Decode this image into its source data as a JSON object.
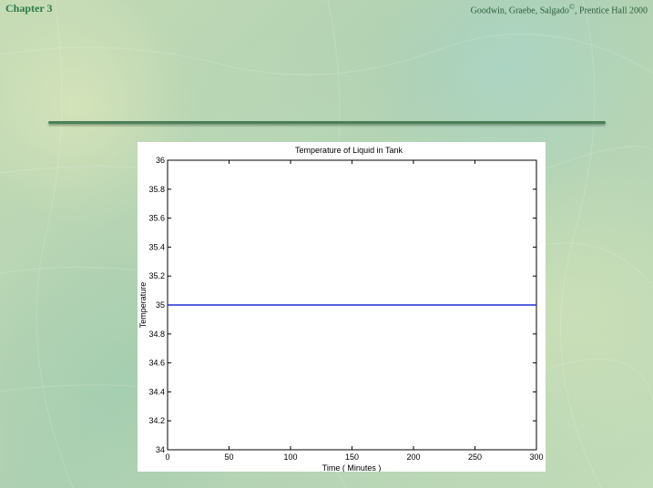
{
  "header": {
    "chapter": "Chapter 3",
    "credit": "Goodwin, Graebe, Salgado",
    "copyright_symbol": "©",
    "credit_suffix": ", Prentice Hall 2000"
  },
  "colors": {
    "line": "#1f2fd6",
    "accent_text": "#2f7a4a",
    "divider": "#4c7f58"
  },
  "chart_data": {
    "type": "line",
    "title": "Temperature of Liquid in Tank",
    "xlabel": "Time ( Minutes )",
    "ylabel": "Temperature",
    "xlim": [
      0,
      300
    ],
    "ylim": [
      34,
      36
    ],
    "xticks": [
      "0",
      "50",
      "100",
      "150",
      "200",
      "250",
      "300"
    ],
    "yticks": [
      "34",
      "34.2",
      "34.4",
      "34.6",
      "34.8",
      "35",
      "35.2",
      "35.4",
      "35.6",
      "35.8",
      "36"
    ],
    "grid": false,
    "series": [
      {
        "x": [
          0,
          300
        ],
        "y": [
          35,
          35
        ]
      }
    ]
  }
}
